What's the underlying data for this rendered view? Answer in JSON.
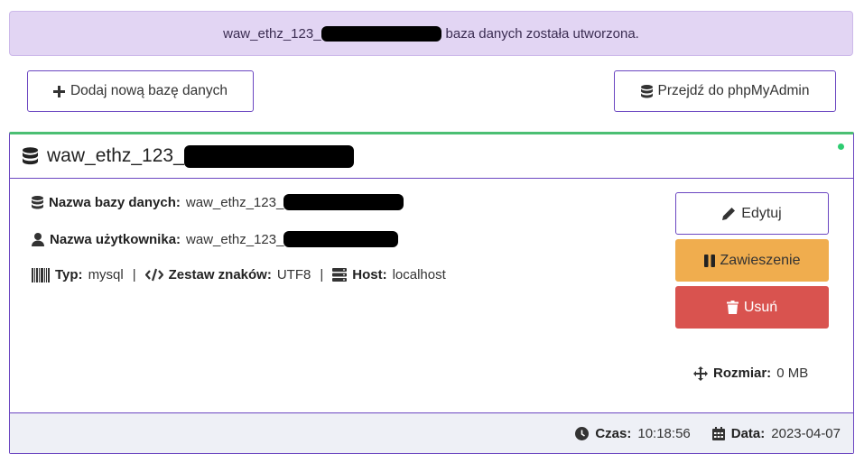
{
  "alert": {
    "db_prefix": "waw_ethz_123_",
    "message": "baza danych została utworzona."
  },
  "toolbar": {
    "add_label": "Dodaj nową bazę danych",
    "pma_label": "Przejdź do phpMyAdmin"
  },
  "card": {
    "title_prefix": "waw_ethz_123_",
    "db_name_label": "Nazwa bazy danych:",
    "db_name_value": "waw_ethz_123_",
    "user_label": "Nazwa użytkownika:",
    "user_value": "waw_ethz_123_",
    "type_label": "Typ:",
    "type_value": "mysql",
    "charset_label": "Zestaw znaków:",
    "charset_value": "UTF8",
    "host_label": "Host:",
    "host_value": "localhost",
    "separator": "|",
    "status_color": "#2ecc71"
  },
  "actions": {
    "edit_label": "Edytuj",
    "suspend_label": "Zawieszenie",
    "delete_label": "Usuń"
  },
  "size": {
    "label": "Rozmiar:",
    "value": "0 MB"
  },
  "footer": {
    "time_label": "Czas:",
    "time_value": "10:18:56",
    "date_label": "Data:",
    "date_value": "2023-04-07"
  },
  "icons": [
    "plus-icon",
    "database-icon",
    "user-icon",
    "barcode-icon",
    "code-icon",
    "server-icon",
    "pencil-icon",
    "pause-icon",
    "trash-icon",
    "arrows-icon",
    "clock-icon",
    "calendar-icon"
  ]
}
